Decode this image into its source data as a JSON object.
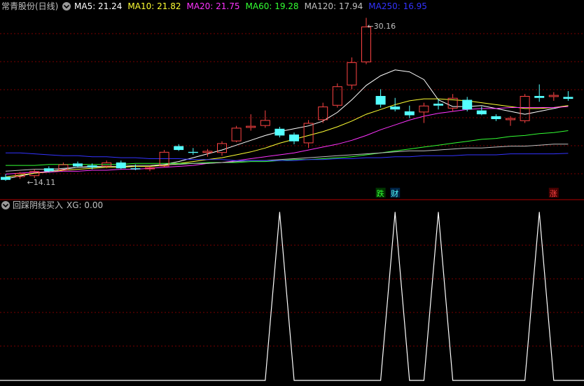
{
  "header": {
    "stock_name": "常青股份(日线)",
    "ma_labels": [
      {
        "text": "MA5: 21.24",
        "color": "#ffffff"
      },
      {
        "text": "MA10: 21.82",
        "color": "#ffff33"
      },
      {
        "text": "MA20: 21.75",
        "color": "#ff33ff"
      },
      {
        "text": "MA60: 19.28",
        "color": "#33ff33"
      },
      {
        "text": "MA120: 17.94",
        "color": "#c0c0c0"
      },
      {
        "text": "MA250: 16.95",
        "color": "#3333ff"
      }
    ]
  },
  "indicator": {
    "title": "回踩阴线买入",
    "xg_label": "XG: 0.00"
  },
  "colors": {
    "up": "#ff4444",
    "down": "#54ffff",
    "grid": "#7a0000",
    "divider": "#b00000"
  },
  "chart_data": [
    {
      "type": "candlestick",
      "title": "常青股份(日线)",
      "ylim": [
        13.6,
        31.4
      ],
      "annotations": [
        {
          "text": "←14.11",
          "index": 1,
          "value": 14.11
        },
        {
          "text": "←30.16",
          "index": 24,
          "value": 30.16
        }
      ],
      "markers": [
        {
          "text": "跌",
          "index": 26,
          "color": "#33ff33",
          "bg": "#003300"
        },
        {
          "text": "财",
          "index": 27,
          "color": "#54ffff",
          "bg": "#002244"
        },
        {
          "text": "涨",
          "index": 38,
          "color": "#ff4444",
          "bg": "#440000"
        }
      ],
      "candles": [
        {
          "o": 14.5,
          "h": 14.8,
          "l": 14.1,
          "c": 14.2
        },
        {
          "o": 14.5,
          "h": 15.0,
          "l": 14.3,
          "c": 14.9
        },
        {
          "o": 14.6,
          "h": 15.3,
          "l": 14.4,
          "c": 15.1
        },
        {
          "o": 15.4,
          "h": 15.6,
          "l": 15.0,
          "c": 15.1
        },
        {
          "o": 15.2,
          "h": 16.0,
          "l": 15.1,
          "c": 15.8
        },
        {
          "o": 15.9,
          "h": 16.1,
          "l": 15.5,
          "c": 15.6
        },
        {
          "o": 15.7,
          "h": 15.9,
          "l": 15.3,
          "c": 15.5
        },
        {
          "o": 15.6,
          "h": 16.2,
          "l": 15.4,
          "c": 16.0
        },
        {
          "o": 16.0,
          "h": 16.2,
          "l": 15.3,
          "c": 15.4
        },
        {
          "o": 15.4,
          "h": 15.8,
          "l": 15.2,
          "c": 15.3
        },
        {
          "o": 15.3,
          "h": 15.6,
          "l": 15.1,
          "c": 15.5
        },
        {
          "o": 15.6,
          "h": 17.3,
          "l": 15.5,
          "c": 17.1
        },
        {
          "o": 17.7,
          "h": 17.9,
          "l": 17.2,
          "c": 17.3
        },
        {
          "o": 17.1,
          "h": 17.5,
          "l": 16.8,
          "c": 17.0
        },
        {
          "o": 17.0,
          "h": 17.4,
          "l": 16.6,
          "c": 17.2
        },
        {
          "o": 17.0,
          "h": 18.2,
          "l": 16.7,
          "c": 18.0
        },
        {
          "o": 18.2,
          "h": 19.8,
          "l": 18.1,
          "c": 19.6
        },
        {
          "o": 19.6,
          "h": 21.0,
          "l": 19.3,
          "c": 19.8
        },
        {
          "o": 19.8,
          "h": 21.4,
          "l": 19.6,
          "c": 20.4
        },
        {
          "o": 19.5,
          "h": 19.7,
          "l": 18.6,
          "c": 18.8
        },
        {
          "o": 18.9,
          "h": 19.1,
          "l": 17.9,
          "c": 18.2
        },
        {
          "o": 18.0,
          "h": 20.4,
          "l": 17.5,
          "c": 20.1
        },
        {
          "o": 20.4,
          "h": 22.2,
          "l": 20.1,
          "c": 21.8
        },
        {
          "o": 21.9,
          "h": 24.2,
          "l": 21.7,
          "c": 23.9
        },
        {
          "o": 24.0,
          "h": 26.9,
          "l": 23.6,
          "c": 26.4
        },
        {
          "o": 26.4,
          "h": 31.0,
          "l": 26.2,
          "c": 30.1
        },
        {
          "o": 22.9,
          "h": 23.6,
          "l": 21.7,
          "c": 22.0
        },
        {
          "o": 21.8,
          "h": 22.7,
          "l": 21.3,
          "c": 21.5
        },
        {
          "o": 21.3,
          "h": 21.9,
          "l": 20.6,
          "c": 20.9
        },
        {
          "o": 21.2,
          "h": 22.2,
          "l": 20.1,
          "c": 21.9
        },
        {
          "o": 22.1,
          "h": 22.6,
          "l": 21.5,
          "c": 21.9
        },
        {
          "o": 21.6,
          "h": 23.1,
          "l": 21.3,
          "c": 22.7
        },
        {
          "o": 22.5,
          "h": 22.8,
          "l": 21.3,
          "c": 21.5
        },
        {
          "o": 21.4,
          "h": 21.8,
          "l": 20.9,
          "c": 21.0
        },
        {
          "o": 20.8,
          "h": 21.0,
          "l": 20.3,
          "c": 20.5
        },
        {
          "o": 20.4,
          "h": 20.8,
          "l": 19.8,
          "c": 20.6
        },
        {
          "o": 20.3,
          "h": 23.1,
          "l": 20.1,
          "c": 22.9
        },
        {
          "o": 22.9,
          "h": 24.1,
          "l": 22.3,
          "c": 22.7
        },
        {
          "o": 22.8,
          "h": 23.3,
          "l": 22.4,
          "c": 23.0
        },
        {
          "o": 22.8,
          "h": 23.4,
          "l": 22.4,
          "c": 22.6
        }
      ],
      "ma_series": [
        {
          "name": "MA5",
          "color": "#ffffff",
          "values": [
            14.3,
            14.6,
            14.9,
            15.1,
            15.3,
            15.5,
            15.6,
            15.6,
            15.6,
            15.6,
            15.6,
            15.8,
            16.1,
            16.5,
            16.9,
            17.3,
            17.8,
            18.3,
            18.8,
            19.2,
            19.5,
            19.8,
            20.3,
            21.2,
            22.5,
            24.0,
            25.0,
            25.6,
            25.4,
            24.6,
            22.5,
            21.8,
            21.8,
            21.9,
            21.6,
            21.3,
            21.0,
            21.3,
            21.6,
            21.9
          ]
        },
        {
          "name": "MA10",
          "color": "#ffff33",
          "values": [
            14.5,
            14.7,
            14.9,
            15.0,
            15.2,
            15.3,
            15.4,
            15.5,
            15.5,
            15.6,
            15.6,
            15.7,
            15.9,
            16.1,
            16.3,
            16.5,
            16.8,
            17.1,
            17.5,
            18.0,
            18.4,
            18.8,
            19.2,
            19.7,
            20.3,
            21.0,
            21.5,
            22.0,
            22.4,
            22.6,
            22.6,
            22.5,
            22.4,
            22.2,
            22.0,
            21.8,
            21.6,
            21.6,
            21.7,
            21.9
          ]
        },
        {
          "name": "MA20",
          "color": "#ff33ff",
          "values": [
            14.8,
            14.9,
            15.0,
            15.0,
            15.1,
            15.1,
            15.2,
            15.2,
            15.3,
            15.3,
            15.4,
            15.5,
            15.6,
            15.7,
            15.9,
            16.0,
            16.2,
            16.4,
            16.6,
            16.8,
            17.0,
            17.3,
            17.6,
            17.9,
            18.3,
            18.8,
            19.4,
            19.9,
            20.4,
            20.8,
            21.1,
            21.3,
            21.5,
            21.6,
            21.6,
            21.7,
            21.7,
            21.7,
            21.7,
            21.8
          ]
        },
        {
          "name": "MA60",
          "color": "#33ff33",
          "values": [
            15.7,
            15.7,
            15.7,
            15.8,
            15.8,
            15.8,
            15.8,
            15.8,
            15.8,
            15.9,
            15.9,
            15.9,
            15.9,
            15.9,
            16.0,
            16.0,
            16.0,
            16.1,
            16.1,
            16.2,
            16.3,
            16.3,
            16.4,
            16.5,
            16.6,
            16.8,
            17.0,
            17.2,
            17.4,
            17.6,
            17.8,
            18.0,
            18.2,
            18.4,
            18.5,
            18.7,
            18.8,
            19.0,
            19.1,
            19.3
          ]
        },
        {
          "name": "MA120",
          "color": "#c0c0c0",
          "values": [
            15.1,
            15.2,
            15.3,
            15.3,
            15.4,
            15.5,
            15.5,
            15.6,
            15.6,
            15.7,
            15.7,
            15.8,
            15.8,
            15.9,
            15.9,
            16.0,
            16.1,
            16.2,
            16.2,
            16.3,
            16.4,
            16.5,
            16.6,
            16.7,
            16.8,
            16.9,
            17.0,
            17.1,
            17.2,
            17.2,
            17.3,
            17.4,
            17.5,
            17.5,
            17.6,
            17.7,
            17.7,
            17.8,
            17.9,
            17.9
          ]
        },
        {
          "name": "MA250",
          "color": "#3333ff",
          "values": [
            17.0,
            17.0,
            16.9,
            16.8,
            16.7,
            16.7,
            16.6,
            16.6,
            16.5,
            16.5,
            16.4,
            16.4,
            16.4,
            16.3,
            16.3,
            16.3,
            16.2,
            16.2,
            16.2,
            16.2,
            16.2,
            16.3,
            16.3,
            16.4,
            16.4,
            16.5,
            16.5,
            16.6,
            16.6,
            16.7,
            16.7,
            16.7,
            16.8,
            16.8,
            16.8,
            16.9,
            16.9,
            16.9,
            16.9,
            16.95
          ]
        }
      ]
    },
    {
      "type": "line",
      "title": "回踩阴线买入",
      "series": [
        {
          "name": "XG",
          "color": "#ffffff",
          "values": [
            0,
            0,
            0,
            0,
            0,
            0,
            0,
            0,
            0,
            0,
            0,
            0,
            0,
            0,
            0,
            0,
            0,
            0,
            0,
            1,
            0,
            0,
            0,
            0,
            0,
            0,
            0,
            1,
            0,
            0,
            1,
            0,
            0,
            0,
            0,
            0,
            0,
            1,
            0,
            0
          ]
        }
      ],
      "ylim": [
        0,
        1
      ]
    }
  ]
}
